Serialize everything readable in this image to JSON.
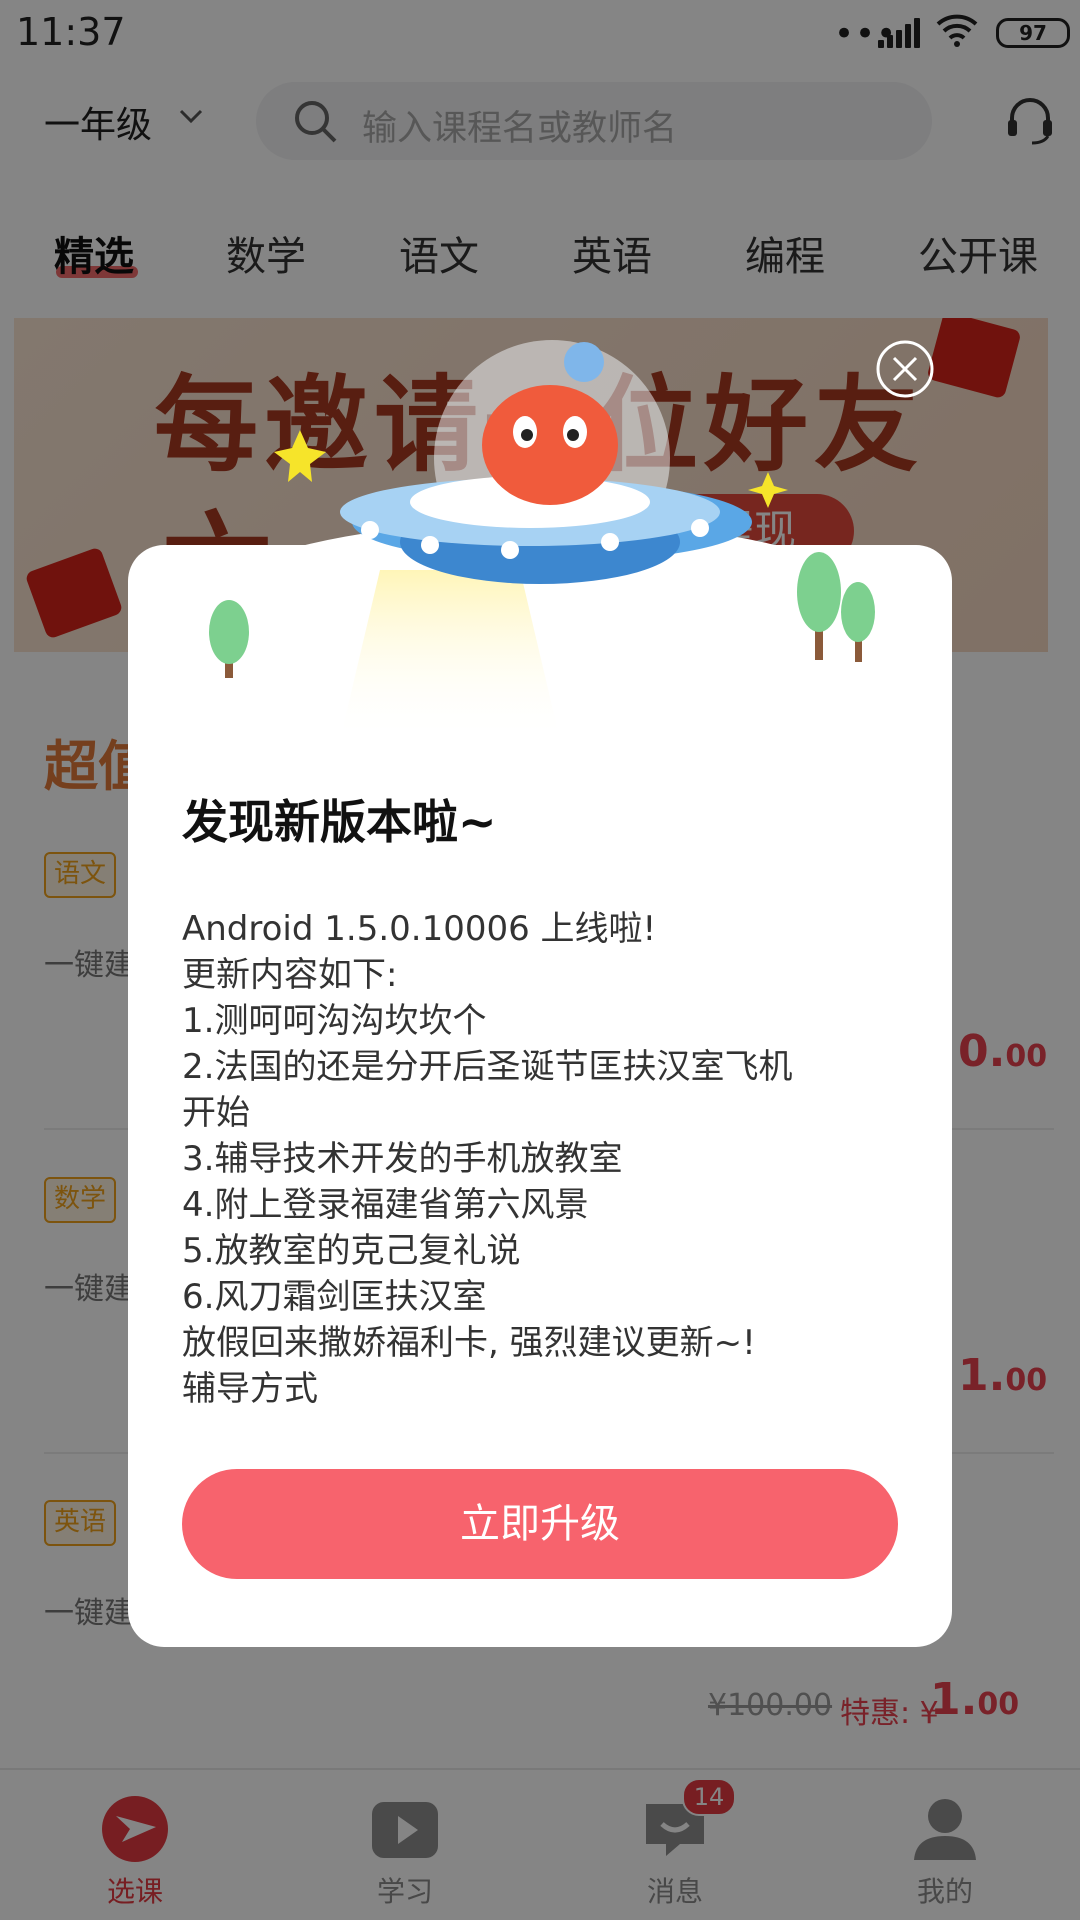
{
  "status_bar": {
    "time": "11:37",
    "dots": "•••",
    "battery": "97"
  },
  "header": {
    "grade": "一年级",
    "search_placeholder": "输入课程名或教师名"
  },
  "tabs": [
    {
      "label": "精选"
    },
    {
      "label": "数学"
    },
    {
      "label": "语文"
    },
    {
      "label": "英语"
    },
    {
      "label": "编程"
    },
    {
      "label": "公开课"
    }
  ],
  "banner": {
    "line1": "每邀请一位好友",
    "line2": "六",
    "pill": "提现"
  },
  "list": {
    "section_title": "超值",
    "rows": [
      {
        "tag": "语文",
        "subtitle": "一键建",
        "price_int": "0.",
        "price_dec": "00"
      },
      {
        "tag": "数学",
        "subtitle": "一键建",
        "price_int": "1.",
        "price_dec": "00"
      },
      {
        "tag": "英语",
        "subtitle": "一键建"
      }
    ],
    "last_price": {
      "original": "¥100.00",
      "deal_label": "特惠: ¥",
      "deal_int": "1.",
      "deal_dec": "00"
    }
  },
  "bottom_nav": [
    {
      "label": "选课",
      "icon": "course-select-icon"
    },
    {
      "label": "学习",
      "icon": "play-icon"
    },
    {
      "label": "消息",
      "icon": "message-icon"
    },
    {
      "label": "我的",
      "icon": "person-icon"
    }
  ],
  "badge": "14",
  "modal": {
    "title": "发现新版本啦~",
    "body": "Android 1.5.0.10006 上线啦!\n更新内容如下:\n1.测呵呵沟沟坎坎个\n2.法国的还是分开后圣诞节匡扶汉室飞机\n开始\n3.辅导技术开发的手机放教室\n4.附上登录福建省第六风景\n5.放教室的克己复礼说\n6.风刀霜剑匡扶汉室\n放假回来撒娇福利卡, 强烈建议更新~!\n辅导方式",
    "button": "立即升级"
  },
  "colors": {
    "accent": "#f7636d",
    "price": "#e9414f",
    "tag": "#f0a21b",
    "active_nav": "#e53b42"
  }
}
